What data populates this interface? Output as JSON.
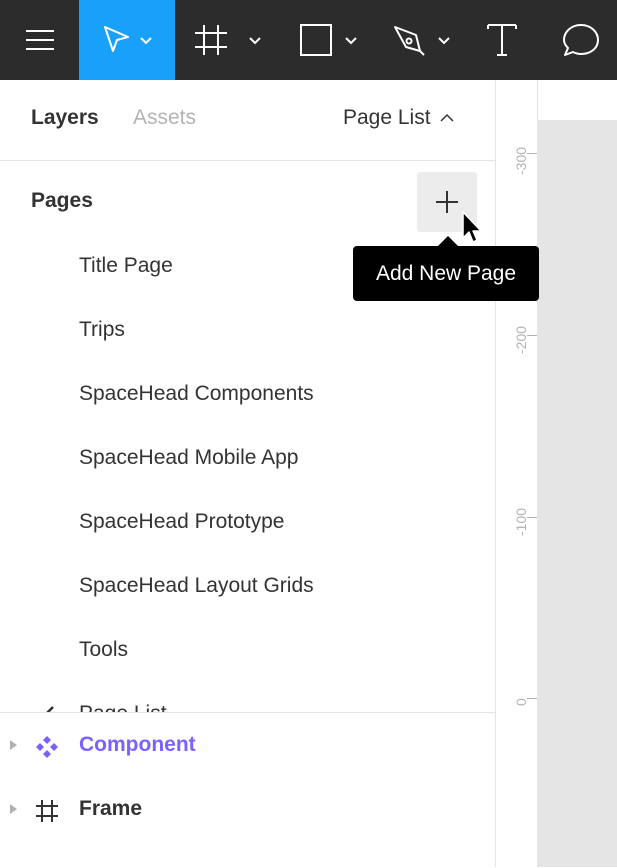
{
  "toolbar": {
    "icons": [
      "menu-icon",
      "move-tool-icon",
      "frame-tool-icon",
      "shape-tool-icon",
      "pen-tool-icon",
      "text-tool-icon",
      "comment-icon"
    ],
    "active_color": "#18a0fb",
    "background_color": "#2c2c2c"
  },
  "panel": {
    "tabs": [
      {
        "label": "Layers",
        "active": true
      },
      {
        "label": "Assets",
        "active": false
      }
    ],
    "page_list_toggle": "Page List"
  },
  "pages": {
    "header": "Pages",
    "add_tooltip": "Add New Page",
    "items": [
      "Title Page",
      "Trips",
      "SpaceHead Components",
      "SpaceHead Mobile App",
      "SpaceHead Prototype",
      "SpaceHead Layout Grids",
      "Tools",
      "Page List"
    ],
    "current": "Page List"
  },
  "layers": {
    "items": [
      {
        "label": "Component",
        "type": "component",
        "color": "#7b61ff"
      },
      {
        "label": "Frame",
        "type": "frame",
        "color": "#333333"
      }
    ]
  },
  "ruler": {
    "labels": [
      "-300",
      "-200",
      "-100",
      "0"
    ]
  }
}
